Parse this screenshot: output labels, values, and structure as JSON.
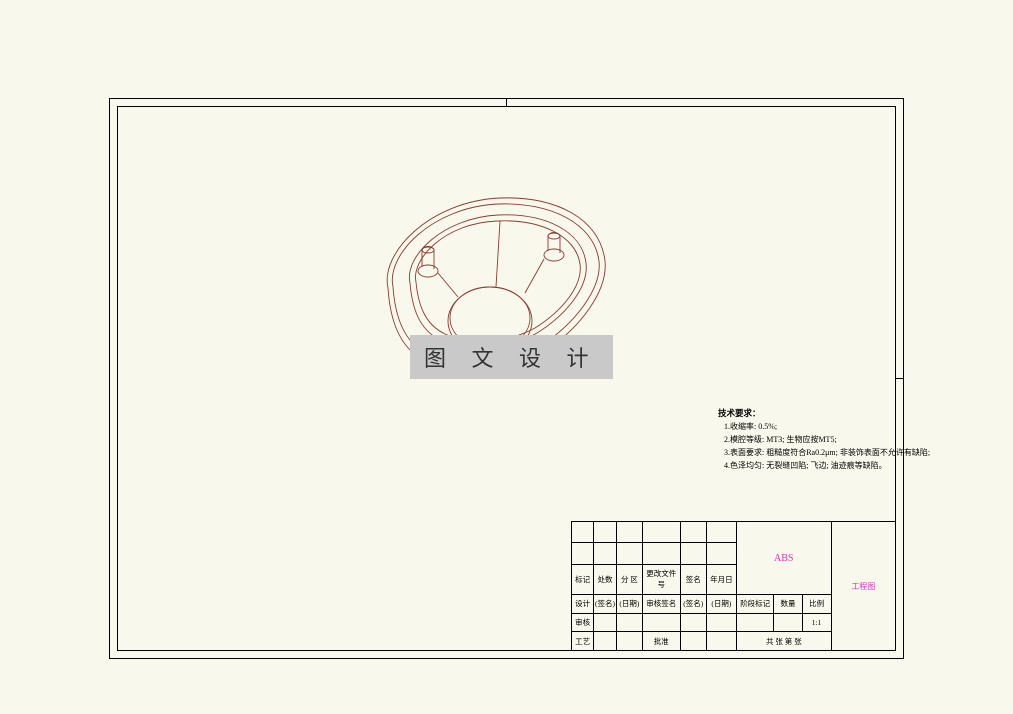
{
  "watermark": "图 文 设 计",
  "tech": {
    "title": "技术要求：",
    "items": [
      "1.收缩率: 0.5%;",
      "2.模腔等级: MT3; 生物应按MT5;",
      "3.表面要求: 粗糙度符合Ra0.2μm; 非装饰表面不允许有缺陷;",
      "4.色泽均匀: 无裂缝凹陷; 飞边; 油迹痕等缺陷。"
    ]
  },
  "titleblock": {
    "material": "ABS",
    "drawing_type": "工程图",
    "row_hdr": {
      "c1": "标记",
      "c2": "处数",
      "c3": "分  区",
      "c4": "更改文件号",
      "c5": "签名",
      "c6": "年月日"
    },
    "row_a": {
      "c1": "设计",
      "c2": "(签名)",
      "c3": "(日期)",
      "c4": "审核签名",
      "c5": "(签名)",
      "c6": "(日期)"
    },
    "row_b": {
      "c1": "审核"
    },
    "row_c": {
      "c1": "工艺",
      "c4": "批准"
    },
    "right": {
      "r1": "阶段标记",
      "r2": "数量",
      "r3": "比例",
      "scale": "1:1",
      "sheet": "共   张   第   张"
    }
  }
}
